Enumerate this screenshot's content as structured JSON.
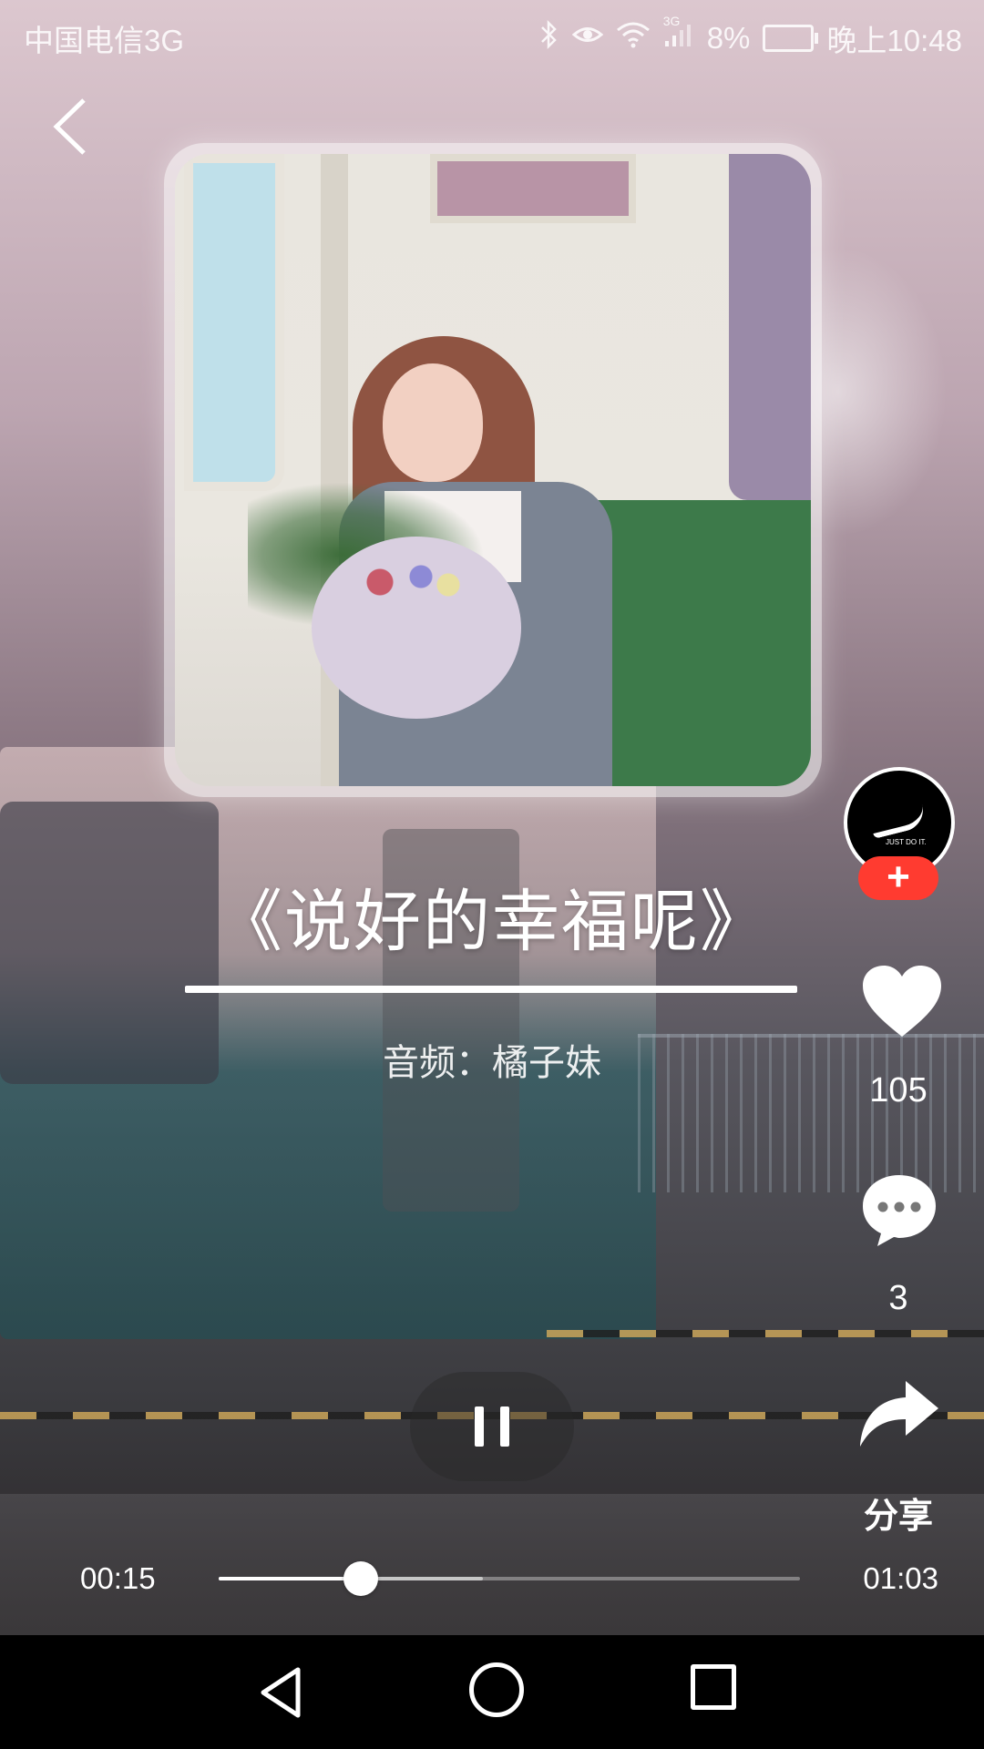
{
  "status_bar": {
    "carrier": "中国电信3G",
    "network": "3G",
    "battery": "8%",
    "time": "晚上10:48",
    "icons": [
      "bluetooth-icon",
      "eye-icon",
      "wifi-icon",
      "signal-icon",
      "battery-icon"
    ]
  },
  "track": {
    "title": "《说好的幸福呢》",
    "audio_credit": "音频：橘子妹"
  },
  "actions": {
    "follow_label": "+",
    "like_count": "105",
    "comment_count": "3",
    "share_label": "分享"
  },
  "player": {
    "current_time": "00:15",
    "total_time": "01:03",
    "progress_fraction": 0.245,
    "buffered_fraction": 0.455,
    "state": "playing"
  },
  "colors": {
    "follow_badge": "#ff3b30",
    "text": "#ffffff",
    "nav_bar": "#000000"
  }
}
